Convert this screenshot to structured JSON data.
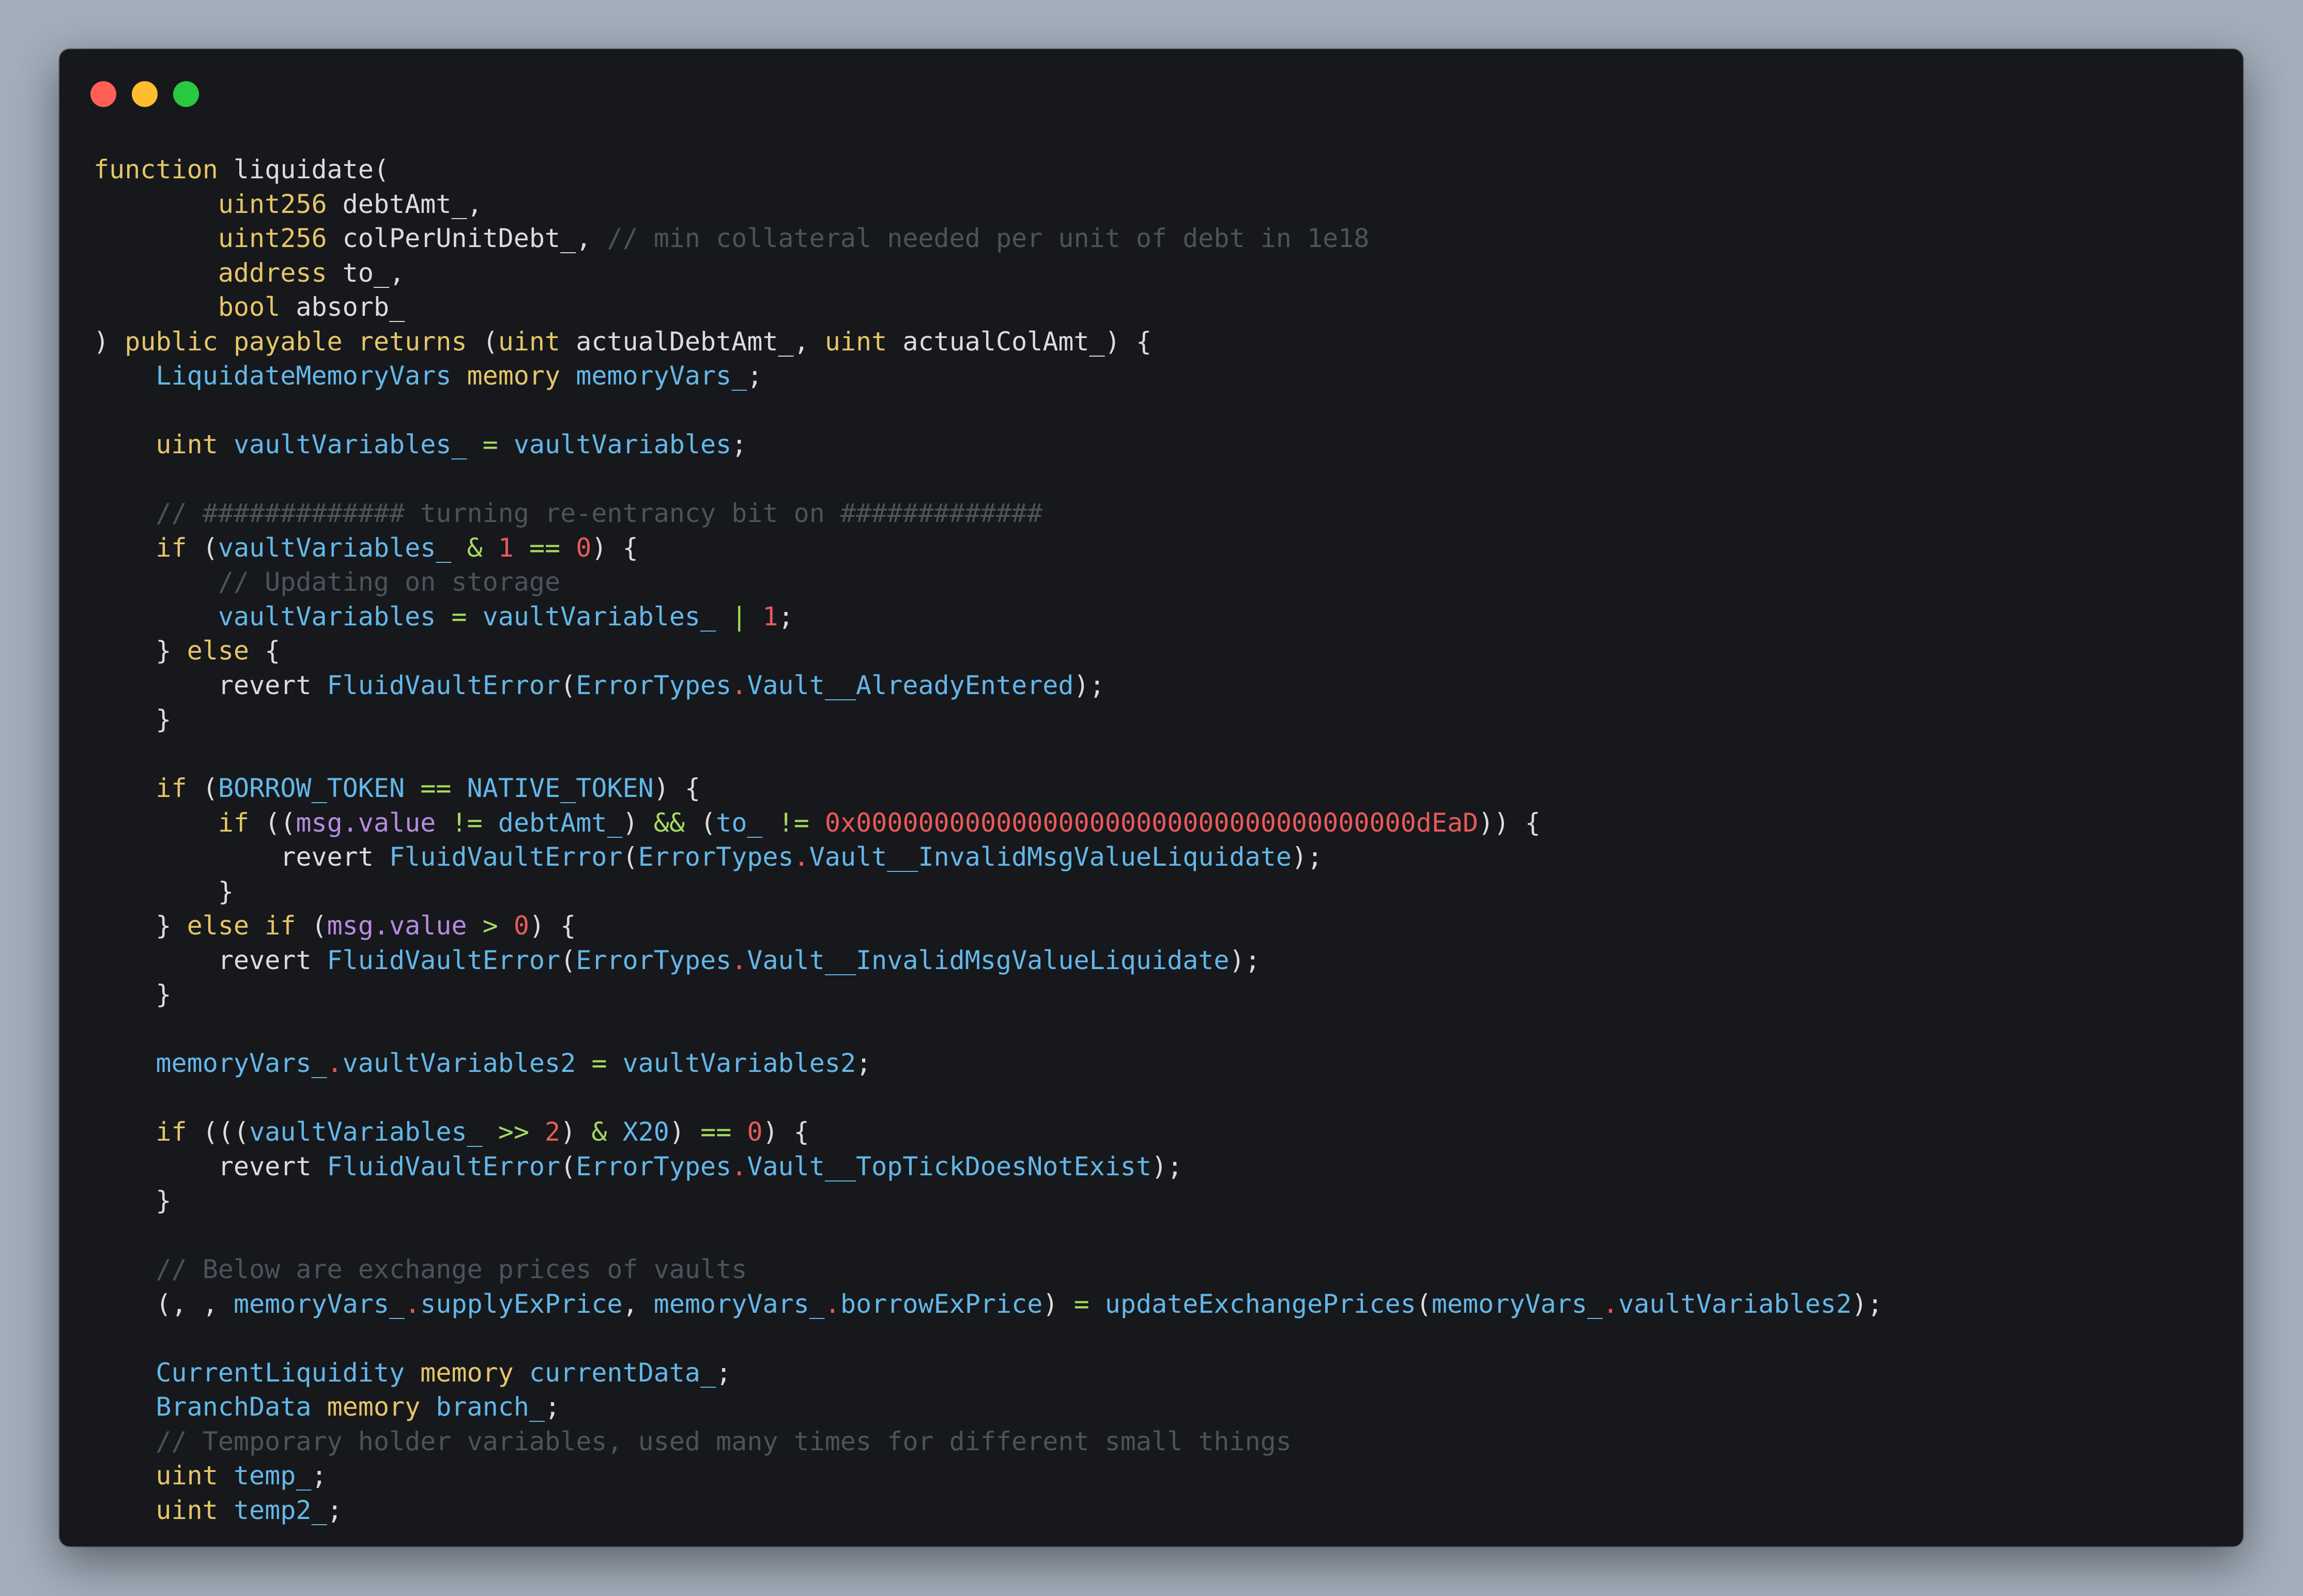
{
  "window": {
    "buttons": [
      {
        "name": "close-button",
        "color": "#ff5f57"
      },
      {
        "name": "minimize-button",
        "color": "#febc2e"
      },
      {
        "name": "zoom-button",
        "color": "#28c840"
      }
    ]
  },
  "palette": {
    "keyword": "#e6c567",
    "identifier": "#64b7e8",
    "number": "#e85a5a",
    "operator": "#a6da5f",
    "comment": "#4b535b",
    "msg": "#b78be0",
    "plain": "#dcdcdc"
  },
  "code": {
    "lines": [
      [
        [
          "kw",
          "function"
        ],
        [
          "pl",
          " liquidate("
        ]
      ],
      [
        [
          "pl",
          "        "
        ],
        [
          "ty",
          "uint256"
        ],
        [
          "pl",
          " debtAmt_,"
        ]
      ],
      [
        [
          "pl",
          "        "
        ],
        [
          "ty",
          "uint256"
        ],
        [
          "pl",
          " colPerUnitDebt_, "
        ],
        [
          "cm",
          "// min collateral needed per unit of debt in 1e18"
        ]
      ],
      [
        [
          "pl",
          "        "
        ],
        [
          "ty",
          "address"
        ],
        [
          "pl",
          " to_,"
        ]
      ],
      [
        [
          "pl",
          "        "
        ],
        [
          "ty",
          "bool"
        ],
        [
          "pl",
          " absorb_"
        ]
      ],
      [
        [
          "pl",
          ") "
        ],
        [
          "kw",
          "public payable returns"
        ],
        [
          "pl",
          " ("
        ],
        [
          "ty",
          "uint"
        ],
        [
          "pl",
          " actualDebtAmt_, "
        ],
        [
          "ty",
          "uint"
        ],
        [
          "pl",
          " actualColAmt_) {"
        ]
      ],
      [
        [
          "pl",
          "    "
        ],
        [
          "id",
          "LiquidateMemoryVars"
        ],
        [
          "pl",
          " "
        ],
        [
          "kw",
          "memory"
        ],
        [
          "pl",
          " "
        ],
        [
          "id",
          "memoryVars_"
        ],
        [
          "pl",
          ";"
        ]
      ],
      [],
      [
        [
          "pl",
          "    "
        ],
        [
          "ty",
          "uint"
        ],
        [
          "pl",
          " "
        ],
        [
          "id",
          "vaultVariables_"
        ],
        [
          "pl",
          " "
        ],
        [
          "op",
          "="
        ],
        [
          "pl",
          " "
        ],
        [
          "id",
          "vaultVariables"
        ],
        [
          "pl",
          ";"
        ]
      ],
      [],
      [
        [
          "pl",
          "    "
        ],
        [
          "cm",
          "// ############# turning re-entrancy bit on #############"
        ]
      ],
      [
        [
          "pl",
          "    "
        ],
        [
          "kw",
          "if"
        ],
        [
          "pl",
          " ("
        ],
        [
          "id",
          "vaultVariables_"
        ],
        [
          "pl",
          " "
        ],
        [
          "op",
          "&"
        ],
        [
          "pl",
          " "
        ],
        [
          "nm",
          "1"
        ],
        [
          "pl",
          " "
        ],
        [
          "op",
          "=="
        ],
        [
          "pl",
          " "
        ],
        [
          "nm",
          "0"
        ],
        [
          "pl",
          ") {"
        ]
      ],
      [
        [
          "pl",
          "        "
        ],
        [
          "cm",
          "// Updating on storage"
        ]
      ],
      [
        [
          "pl",
          "        "
        ],
        [
          "id",
          "vaultVariables"
        ],
        [
          "pl",
          " "
        ],
        [
          "op",
          "="
        ],
        [
          "pl",
          " "
        ],
        [
          "id",
          "vaultVariables_"
        ],
        [
          "pl",
          " "
        ],
        [
          "op",
          "|"
        ],
        [
          "pl",
          " "
        ],
        [
          "nm",
          "1"
        ],
        [
          "pl",
          ";"
        ]
      ],
      [
        [
          "pl",
          "    } "
        ],
        [
          "kw",
          "else"
        ],
        [
          "pl",
          " {"
        ]
      ],
      [
        [
          "pl",
          "        revert "
        ],
        [
          "id",
          "FluidVaultError"
        ],
        [
          "pl",
          "("
        ],
        [
          "id",
          "ErrorTypes"
        ],
        [
          "dt",
          "."
        ],
        [
          "id",
          "Vault__AlreadyEntered"
        ],
        [
          "pl",
          ");"
        ]
      ],
      [
        [
          "pl",
          "    }"
        ]
      ],
      [],
      [
        [
          "pl",
          "    "
        ],
        [
          "kw",
          "if"
        ],
        [
          "pl",
          " ("
        ],
        [
          "id",
          "BORROW_TOKEN"
        ],
        [
          "pl",
          " "
        ],
        [
          "op",
          "=="
        ],
        [
          "pl",
          " "
        ],
        [
          "id",
          "NATIVE_TOKEN"
        ],
        [
          "pl",
          ") {"
        ]
      ],
      [
        [
          "pl",
          "        "
        ],
        [
          "kw",
          "if"
        ],
        [
          "pl",
          " (("
        ],
        [
          "mg",
          "msg.value"
        ],
        [
          "pl",
          " "
        ],
        [
          "op",
          "!="
        ],
        [
          "pl",
          " "
        ],
        [
          "id",
          "debtAmt_"
        ],
        [
          "pl",
          ") "
        ],
        [
          "op",
          "&&"
        ],
        [
          "pl",
          " ("
        ],
        [
          "id",
          "to_"
        ],
        [
          "pl",
          " "
        ],
        [
          "op",
          "!="
        ],
        [
          "pl",
          " "
        ],
        [
          "nm",
          "0x000000000000000000000000000000000000dEaD"
        ],
        [
          "pl",
          ")) {"
        ]
      ],
      [
        [
          "pl",
          "            revert "
        ],
        [
          "id",
          "FluidVaultError"
        ],
        [
          "pl",
          "("
        ],
        [
          "id",
          "ErrorTypes"
        ],
        [
          "dt",
          "."
        ],
        [
          "id",
          "Vault__InvalidMsgValueLiquidate"
        ],
        [
          "pl",
          ");"
        ]
      ],
      [
        [
          "pl",
          "        }"
        ]
      ],
      [
        [
          "pl",
          "    } "
        ],
        [
          "kw",
          "else if"
        ],
        [
          "pl",
          " ("
        ],
        [
          "mg",
          "msg.value"
        ],
        [
          "pl",
          " "
        ],
        [
          "op",
          ">"
        ],
        [
          "pl",
          " "
        ],
        [
          "nm",
          "0"
        ],
        [
          "pl",
          ") {"
        ]
      ],
      [
        [
          "pl",
          "        revert "
        ],
        [
          "id",
          "FluidVaultError"
        ],
        [
          "pl",
          "("
        ],
        [
          "id",
          "ErrorTypes"
        ],
        [
          "dt",
          "."
        ],
        [
          "id",
          "Vault__InvalidMsgValueLiquidate"
        ],
        [
          "pl",
          ");"
        ]
      ],
      [
        [
          "pl",
          "    }"
        ]
      ],
      [],
      [
        [
          "pl",
          "    "
        ],
        [
          "id",
          "memoryVars_"
        ],
        [
          "dt",
          "."
        ],
        [
          "id",
          "vaultVariables2"
        ],
        [
          "pl",
          " "
        ],
        [
          "op",
          "="
        ],
        [
          "pl",
          " "
        ],
        [
          "id",
          "vaultVariables2"
        ],
        [
          "pl",
          ";"
        ]
      ],
      [],
      [
        [
          "pl",
          "    "
        ],
        [
          "kw",
          "if"
        ],
        [
          "pl",
          " ((("
        ],
        [
          "id",
          "vaultVariables_"
        ],
        [
          "pl",
          " "
        ],
        [
          "op",
          ">>"
        ],
        [
          "pl",
          " "
        ],
        [
          "nm",
          "2"
        ],
        [
          "pl",
          ") "
        ],
        [
          "op",
          "&"
        ],
        [
          "pl",
          " "
        ],
        [
          "id",
          "X20"
        ],
        [
          "pl",
          ") "
        ],
        [
          "op",
          "=="
        ],
        [
          "pl",
          " "
        ],
        [
          "nm",
          "0"
        ],
        [
          "pl",
          ") {"
        ]
      ],
      [
        [
          "pl",
          "        revert "
        ],
        [
          "id",
          "FluidVaultError"
        ],
        [
          "pl",
          "("
        ],
        [
          "id",
          "ErrorTypes"
        ],
        [
          "dt",
          "."
        ],
        [
          "id",
          "Vault__TopTickDoesNotExist"
        ],
        [
          "pl",
          ");"
        ]
      ],
      [
        [
          "pl",
          "    }"
        ]
      ],
      [],
      [
        [
          "pl",
          "    "
        ],
        [
          "cm",
          "// Below are exchange prices of vaults"
        ]
      ],
      [
        [
          "pl",
          "    (, , "
        ],
        [
          "id",
          "memoryVars_"
        ],
        [
          "dt",
          "."
        ],
        [
          "id",
          "supplyExPrice"
        ],
        [
          "pl",
          ", "
        ],
        [
          "id",
          "memoryVars_"
        ],
        [
          "dt",
          "."
        ],
        [
          "id",
          "borrowExPrice"
        ],
        [
          "pl",
          ") "
        ],
        [
          "op",
          "="
        ],
        [
          "pl",
          " "
        ],
        [
          "id",
          "updateExchangePrices"
        ],
        [
          "pl",
          "("
        ],
        [
          "id",
          "memoryVars_"
        ],
        [
          "dt",
          "."
        ],
        [
          "id",
          "vaultVariables2"
        ],
        [
          "pl",
          ");"
        ]
      ],
      [],
      [
        [
          "pl",
          "    "
        ],
        [
          "id",
          "CurrentLiquidity"
        ],
        [
          "pl",
          " "
        ],
        [
          "kw",
          "memory"
        ],
        [
          "pl",
          " "
        ],
        [
          "id",
          "currentData_"
        ],
        [
          "pl",
          ";"
        ]
      ],
      [
        [
          "pl",
          "    "
        ],
        [
          "id",
          "BranchData"
        ],
        [
          "pl",
          " "
        ],
        [
          "kw",
          "memory"
        ],
        [
          "pl",
          " "
        ],
        [
          "id",
          "branch_"
        ],
        [
          "pl",
          ";"
        ]
      ],
      [
        [
          "pl",
          "    "
        ],
        [
          "cm",
          "// Temporary holder variables, used many times for different small things"
        ]
      ],
      [
        [
          "pl",
          "    "
        ],
        [
          "ty",
          "uint"
        ],
        [
          "pl",
          " "
        ],
        [
          "id",
          "temp_"
        ],
        [
          "pl",
          ";"
        ]
      ],
      [
        [
          "pl",
          "    "
        ],
        [
          "ty",
          "uint"
        ],
        [
          "pl",
          " "
        ],
        [
          "id",
          "temp2_"
        ],
        [
          "pl",
          ";"
        ]
      ]
    ]
  }
}
